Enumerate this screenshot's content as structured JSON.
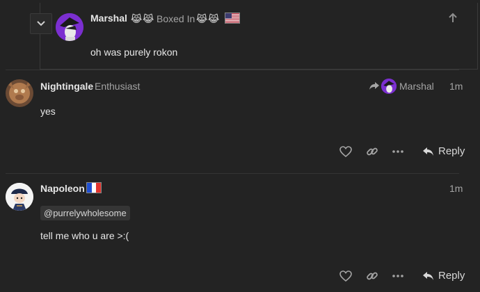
{
  "quoted": {
    "username": "Marshal",
    "title": "Boxed In",
    "text": "oh was purely rokon",
    "emoji_icon": "cat-with-tears-of-joy",
    "flag_icon": "us-flag"
  },
  "posts": [
    {
      "username": "Nightingale",
      "title": "Enthusiast",
      "reply_to": "Marshal",
      "time": "1m",
      "text": "yes",
      "reply_label": "Reply"
    },
    {
      "username": "Napoleon",
      "flag_icon": "france-flag",
      "time": "1m",
      "mention": "@purrelywholesome",
      "text": "tell me who u are >:(",
      "reply_label": "Reply"
    }
  ],
  "colors": {
    "background": "#232323",
    "text": "#e8e8e8",
    "muted": "#a4a4a4",
    "marshal_avatar_bg": "#7b2fd0"
  }
}
